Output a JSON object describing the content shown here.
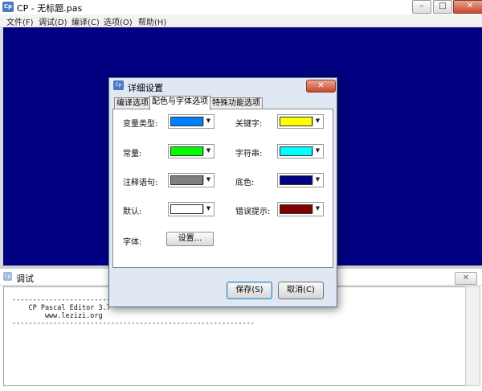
{
  "window": {
    "icon_text": "Cp",
    "title": "CP - 无标题.pas",
    "controls": {
      "minimize": "–",
      "maximize": "□",
      "close": "✕"
    }
  },
  "menu": [
    "文件(F)",
    "调试(D)",
    "编译(C)",
    "选项(O)",
    "帮助(H)"
  ],
  "debug": {
    "title": "调试",
    "close": "✕",
    "lines": [
      "-----------------------------------------------------------",
      "    CP Pascal Editor 3.7",
      "        www.lezizi.org",
      "-----------------------------------------------------------"
    ]
  },
  "dialog": {
    "title": "详细设置",
    "close": "✕",
    "tabs": [
      "编译选项",
      "配色与字体选项",
      "特殊功能选项"
    ],
    "active_tab": 1,
    "colors": {
      "variable_type": {
        "label": "变量类型:",
        "color": "#0080ff"
      },
      "constant": {
        "label": "常量:",
        "color": "#00ff00"
      },
      "comment": {
        "label": "注释语句:",
        "color": "#808080"
      },
      "default": {
        "label": "默认:",
        "color": "#ffffff"
      },
      "keyword": {
        "label": "关键字:",
        "color": "#ffff00"
      },
      "string": {
        "label": "字符串:",
        "color": "#00ffff"
      },
      "background": {
        "label": "底色:",
        "color": "#000080"
      },
      "error": {
        "label": "错误提示:",
        "color": "#800000"
      }
    },
    "font": {
      "label": "字体:",
      "button": "设置..."
    },
    "save_button": "保存(S)",
    "cancel_button": "取消(C)"
  },
  "colors": {
    "editor_background": "#000080"
  }
}
